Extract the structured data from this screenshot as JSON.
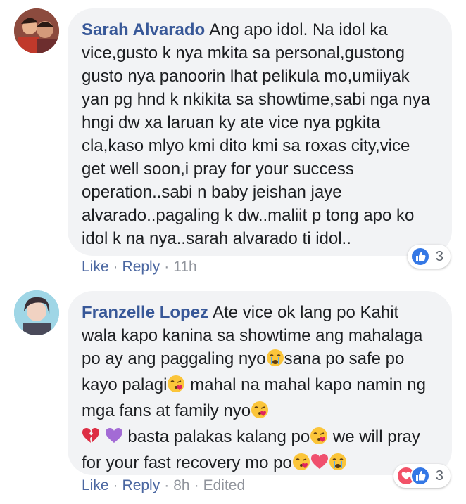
{
  "comments": [
    {
      "author": "Sarah Alvarado",
      "text": "Ang apo idol. Na idol ka vice,gusto k nya mkita sa personal,gustong gusto nya panoorin lhat pelikula mo,umiiyak yan pg hnd k nkikita sa showtime,sabi nga nya hngi dw xa laruan ky ate vice nya pgkita cla,kaso mlyo kmi dito kmi sa roxas city,vice get well soon,i pray for your success operation..sabi n baby jeishan jaye alvarado..pagaling k dw..maliit p tong apo ko idol k na nya..sarah alvarado ti idol..",
      "actions": {
        "like": "Like",
        "reply": "Reply",
        "time": "11h"
      },
      "reactions": {
        "types": [
          "like-icon"
        ],
        "count": "3"
      },
      "colors": {
        "avatar_bg": "#b3574a"
      }
    },
    {
      "author": "Franzelle Lopez",
      "text_parts": [
        "Ate vice ok lang po Kahit wala kapo kanina sa showtime ang mahalaga po ay ang paggaling nyo",
        "sana po safe po kayo palagi",
        " mahal na mahal kapo namin ng mga fans at family nyo",
        " basta palakas kalang po",
        " we will pray for your fast recovery mo po"
      ],
      "actions": {
        "like": "Like",
        "reply": "Reply",
        "time": "8h",
        "edited": "Edited"
      },
      "reactions": {
        "types": [
          "love-icon",
          "like-icon"
        ],
        "count": "3"
      },
      "colors": {
        "avatar_bg": "#7fc4d8"
      }
    }
  ],
  "colors": {
    "author": "#385898",
    "bubble": "#f2f3f5",
    "link": "#4b67a1",
    "meta": "#90949c",
    "like": "#3578e5",
    "love": "#f25268"
  }
}
